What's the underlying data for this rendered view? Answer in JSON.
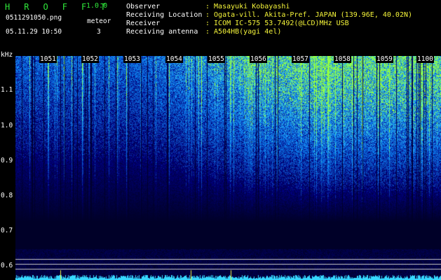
{
  "header": {
    "brand": "H R O F F T",
    "version": "1.0.0",
    "filename": "0511291050.png",
    "datetime": "05.11.29 10:50",
    "meteor_label": "meteor",
    "meteor_count": "3"
  },
  "info": [
    {
      "label": "Observer",
      "value": ": Masayuki Kobayashi"
    },
    {
      "label": "Receiving Location",
      "value": ": Ogata-vill. Akita-Pref. JAPAN (139.96E, 40.02N)"
    },
    {
      "label": "Receiver",
      "value": ": ICOM IC-575 53.7492(@LCD)MHz USB"
    },
    {
      "label": "Receiving antenna",
      "value": ": A504HB(yagi 4el)"
    }
  ],
  "spectrogram": {
    "freq_unit": "kHz",
    "freq_ticks": [
      "1.1",
      "1.0",
      "0.9",
      "0.8",
      "0.7",
      "0.6"
    ],
    "freq_range": [
      0.58,
      1.19
    ],
    "time_ticks": [
      "1051",
      "1052",
      "1053",
      "1054",
      "1055",
      "1056",
      "1057",
      "1058",
      "1059",
      "1100"
    ],
    "colors": {
      "low": "#00003a",
      "mid": "#1a3cff",
      "high": "#37d8ff",
      "peak": "#c8ff3a"
    }
  }
}
